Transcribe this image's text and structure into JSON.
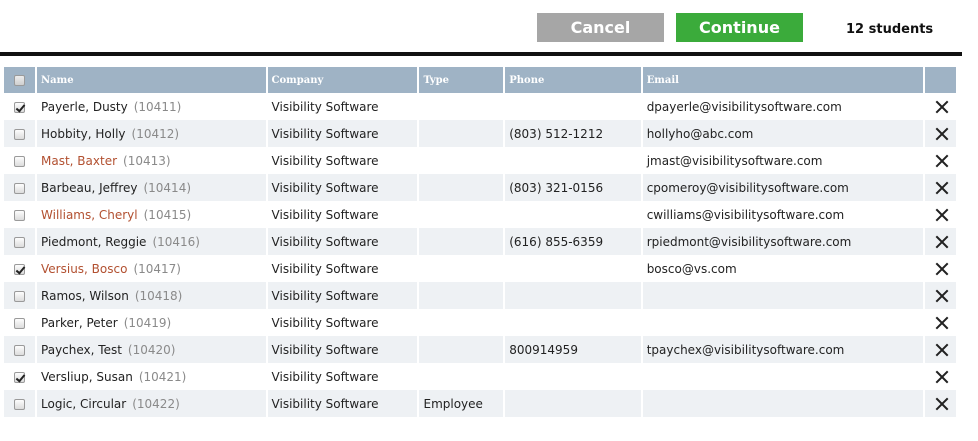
{
  "toolbar": {
    "cancel_label": "Cancel",
    "continue_label": "Continue",
    "count_label": "12 students"
  },
  "colors": {
    "cancel_bg": "#a6a6a6",
    "continue_bg": "#3bab3b",
    "header_bg": "#9fb3c5",
    "name_accent": "#b25030",
    "row_alt_bg": "#eef1f4"
  },
  "table": {
    "header_checkbox_checked": false,
    "columns": [
      "Name",
      "Company",
      "Type",
      "Phone",
      "Email"
    ],
    "rows": [
      {
        "checked": true,
        "name": "Payerle, Dusty",
        "accent": false,
        "id": "(10411)",
        "company": "Visibility Software",
        "type": "",
        "phone": "",
        "email": "dpayerle@visibilitysoftware.com"
      },
      {
        "checked": false,
        "name": "Hobbity, Holly",
        "accent": false,
        "id": "(10412)",
        "company": "Visibility Software",
        "type": "",
        "phone": "(803) 512-1212",
        "email": "hollyho@abc.com"
      },
      {
        "checked": false,
        "name": "Mast, Baxter",
        "accent": true,
        "id": "(10413)",
        "company": "Visibility Software",
        "type": "",
        "phone": "",
        "email": "jmast@visibilitysoftware.com"
      },
      {
        "checked": false,
        "name": "Barbeau, Jeffrey",
        "accent": false,
        "id": "(10414)",
        "company": "Visibility Software",
        "type": "",
        "phone": "(803) 321-0156",
        "email": "cpomeroy@visibilitysoftware.com"
      },
      {
        "checked": false,
        "name": "Williams, Cheryl",
        "accent": true,
        "id": "(10415)",
        "company": "Visibility Software",
        "type": "",
        "phone": "",
        "email": "cwilliams@visibilitysoftware.com"
      },
      {
        "checked": false,
        "name": "Piedmont, Reggie",
        "accent": false,
        "id": "(10416)",
        "company": "Visibility Software",
        "type": "",
        "phone": "(616) 855-6359",
        "email": "rpiedmont@visibilitysoftware.com"
      },
      {
        "checked": true,
        "name": "Versius, Bosco",
        "accent": true,
        "id": "(10417)",
        "company": "Visibility Software",
        "type": "",
        "phone": "",
        "email": "bosco@vs.com"
      },
      {
        "checked": false,
        "name": "Ramos, Wilson",
        "accent": false,
        "id": "(10418)",
        "company": "Visibility Software",
        "type": "",
        "phone": "",
        "email": ""
      },
      {
        "checked": false,
        "name": "Parker, Peter",
        "accent": false,
        "id": "(10419)",
        "company": "Visibility Software",
        "type": "",
        "phone": "",
        "email": ""
      },
      {
        "checked": false,
        "name": "Paychex, Test",
        "accent": false,
        "id": "(10420)",
        "company": "Visibility Software",
        "type": "",
        "phone": "800914959",
        "email": "tpaychex@visibilitysoftware.com"
      },
      {
        "checked": true,
        "name": "Versliup, Susan",
        "accent": false,
        "id": "(10421)",
        "company": "Visibility Software",
        "type": "",
        "phone": "",
        "email": ""
      },
      {
        "checked": false,
        "name": "Logic, Circular",
        "accent": false,
        "id": "(10422)",
        "company": "Visibility Software",
        "type": "Employee",
        "phone": "",
        "email": ""
      }
    ]
  },
  "icons": {
    "row_remove": "close-icon",
    "checkbox": "checkbox-icon"
  }
}
